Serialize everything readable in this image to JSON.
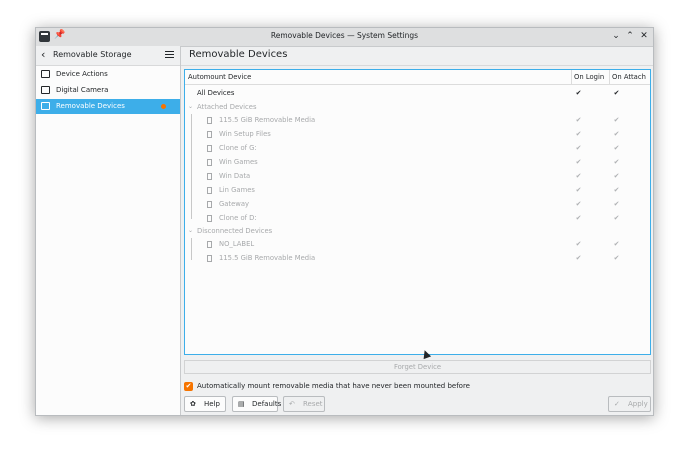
{
  "window": {
    "title": "Removable Devices — System Settings"
  },
  "sidebar": {
    "title": "Removable Storage",
    "items": [
      {
        "label": "Device Actions"
      },
      {
        "label": "Digital Camera"
      },
      {
        "label": "Removable Devices"
      }
    ]
  },
  "main": {
    "title": "Removable Devices"
  },
  "tree": {
    "columns": [
      "Automount Device",
      "On Login",
      "On Attach"
    ],
    "all_devices": "All Devices",
    "attached_group": "Attached Devices",
    "attached": [
      "115.5 GiB Removable Media",
      "Win Setup Files",
      "Clone of G:",
      "Win Games",
      "Win Data",
      "Lin Games",
      "Gateway",
      "Clone of D:"
    ],
    "disconnected_group": "Disconnected Devices",
    "disconnected": [
      "NO_LABEL",
      "115.5 GiB Removable Media"
    ]
  },
  "forget_label": "Forget Device",
  "automount_label": "Automatically mount removable media that have never been mounted before",
  "buttons": {
    "help": "Help",
    "defaults": "Defaults",
    "reset": "Reset",
    "apply": "Apply"
  },
  "colors": {
    "accent": "#3daee9",
    "checkbox_checked": "#f67400"
  }
}
